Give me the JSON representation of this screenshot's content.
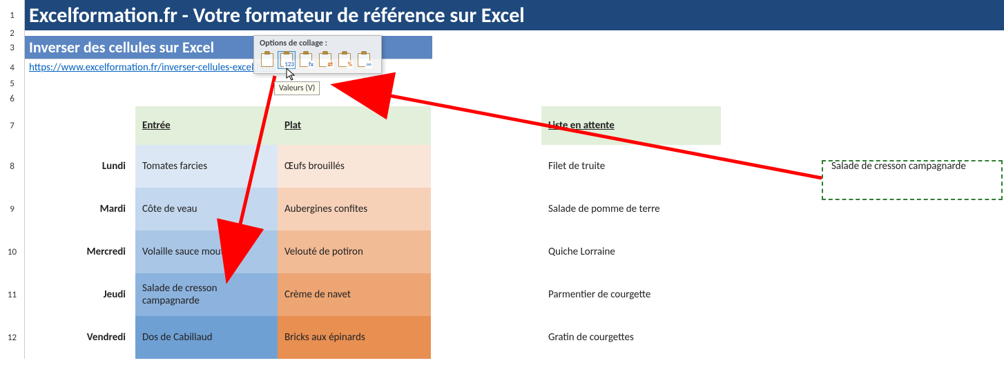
{
  "titles": {
    "main": "Excelformation.fr - Votre formateur de référence sur Excel",
    "sub": "Inverser des cellules sur Excel",
    "link_text": "https://www.excelformation.fr/inverser-cellules-excel.html"
  },
  "row_numbers": [
    "1",
    "2",
    "3",
    "4",
    "5",
    "6",
    "7",
    "8",
    "9",
    "10",
    "11",
    "12"
  ],
  "headers": {
    "entree": "Entrée",
    "plat": "Plat",
    "liste": "Liste en attente"
  },
  "days": [
    "Lundi",
    "Mardi",
    "Mercredi",
    "Jeudi",
    "Vendredi"
  ],
  "entrees": [
    "Tomates farcies",
    "Côte de veau",
    "Volaille sauce moutarde",
    "Salade de cresson campagnarde",
    "Dos de Cabillaud"
  ],
  "plats": [
    "Œufs brouillés",
    "Aubergines confites",
    "Velouté de potiron",
    "Crème de navet",
    "Bricks aux épinards"
  ],
  "liste": [
    "Filet de truite",
    "Salade de pomme de terre",
    "Quiche Lorraine",
    "Parmentier de courgette",
    "Gratin de courgettes"
  ],
  "clipboard_cell": "Salade de cresson campagnarde",
  "paste_popup": {
    "title": "Options de collage :",
    "tooltip": "Valeurs (V)",
    "icons": [
      {
        "name": "paste-all-icon",
        "sub": ""
      },
      {
        "name": "paste-values-icon",
        "sub": "123"
      },
      {
        "name": "paste-formulas-icon",
        "sub": "fx"
      },
      {
        "name": "paste-transpose-icon",
        "sub": "⇄"
      },
      {
        "name": "paste-formatting-icon",
        "sub": "%"
      },
      {
        "name": "paste-link-icon",
        "sub": "∞"
      }
    ]
  }
}
